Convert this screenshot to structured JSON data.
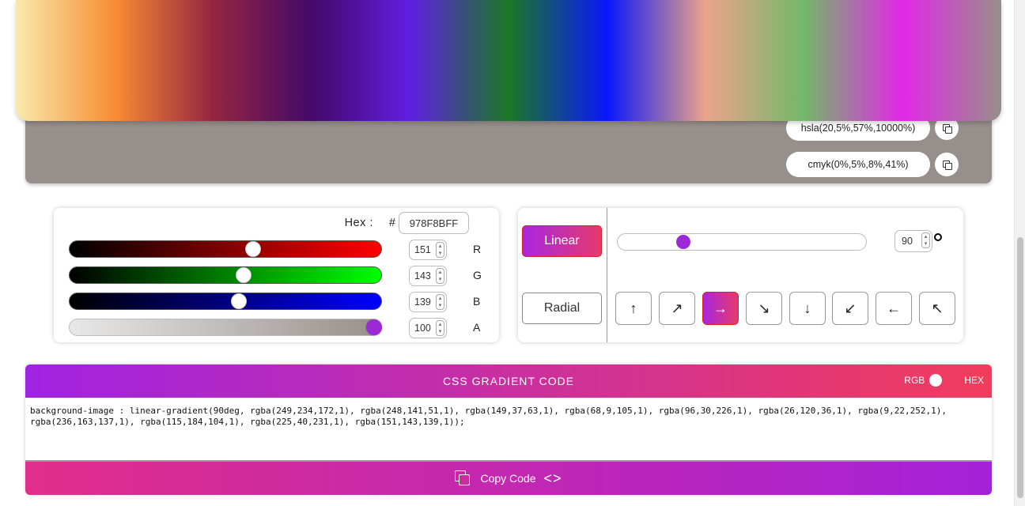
{
  "formats": {
    "hsla": "hsla(20,5%,57%,10000%)",
    "cmyk": "cmyk(0%,5%,8%,41%)"
  },
  "color_panel": {
    "hex_label": "Hex :",
    "hash": "#",
    "hex_value": "978F8BFF",
    "channels": [
      {
        "label": "R",
        "value": "151",
        "fraction": 0.592
      },
      {
        "label": "G",
        "value": "143",
        "fraction": 0.561
      },
      {
        "label": "B",
        "value": "139",
        "fraction": 0.545
      },
      {
        "label": "A",
        "value": "100",
        "fraction": 1.0
      }
    ]
  },
  "gradient_controls": {
    "linear_label": "Linear",
    "radial_label": "Radial",
    "selected_type": "Linear",
    "angle": "90",
    "angle_fraction": 0.25,
    "directions": [
      "↑",
      "↗",
      "→",
      "↘",
      "↓",
      "↙",
      "←",
      "↖"
    ],
    "selected_direction": "→"
  },
  "code_panel": {
    "title": "CSS GRADIENT CODE",
    "rgb_label": "RGB",
    "hex_label": "HEX",
    "code": "background-image : linear-gradient(90deg, rgba(249,234,172,1), rgba(248,141,51,1), rgba(149,37,63,1), rgba(68,9,105,1), rgba(96,30,226,1), rgba(26,120,36,1), rgba(9,22,252,1), rgba(236,163,137,1), rgba(115,184,104,1), rgba(225,40,231,1), rgba(151,143,139,1));",
    "copy_label": "Copy Code",
    "code_icon": "<>"
  },
  "colors": {
    "current": "#978f8b",
    "accent_start": "#a826e0",
    "accent_end": "#e63a6b"
  }
}
